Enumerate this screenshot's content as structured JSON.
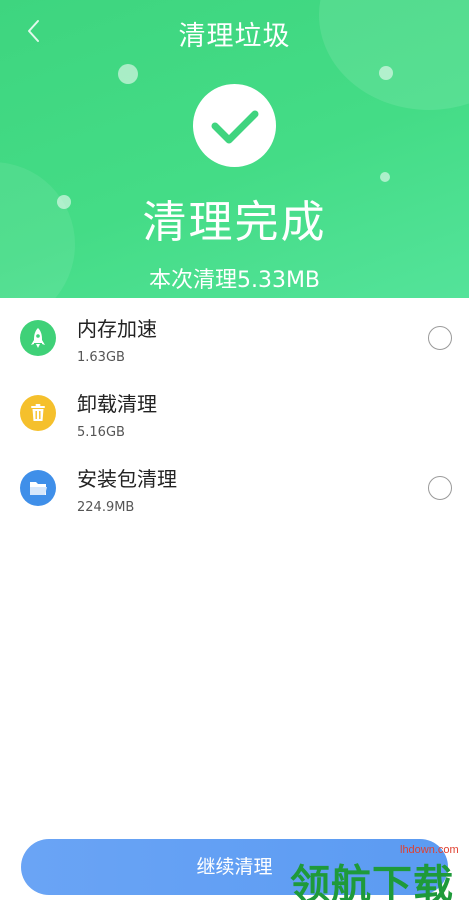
{
  "header": {
    "title": "清理垃圾",
    "status": "清理完成",
    "cleaned_summary": "本次清理5.33MB",
    "accent_color": "#44dc86"
  },
  "items": [
    {
      "label": "内存加速",
      "size": "1.63GB",
      "icon": "rocket-icon",
      "icon_color": "#3fd178",
      "has_radio": true
    },
    {
      "label": "卸载清理",
      "size": "5.16GB",
      "icon": "trash-icon",
      "icon_color": "#f5c02c",
      "has_radio": false
    },
    {
      "label": "安装包清理",
      "size": "224.9MB",
      "icon": "folder-icon",
      "icon_color": "#3f8fe9",
      "has_radio": true
    }
  ],
  "footer": {
    "continue_label": "继续清理",
    "button_color": "#6aa4f5"
  },
  "watermark": {
    "url": "lhdown.com",
    "text": "领航下载"
  }
}
